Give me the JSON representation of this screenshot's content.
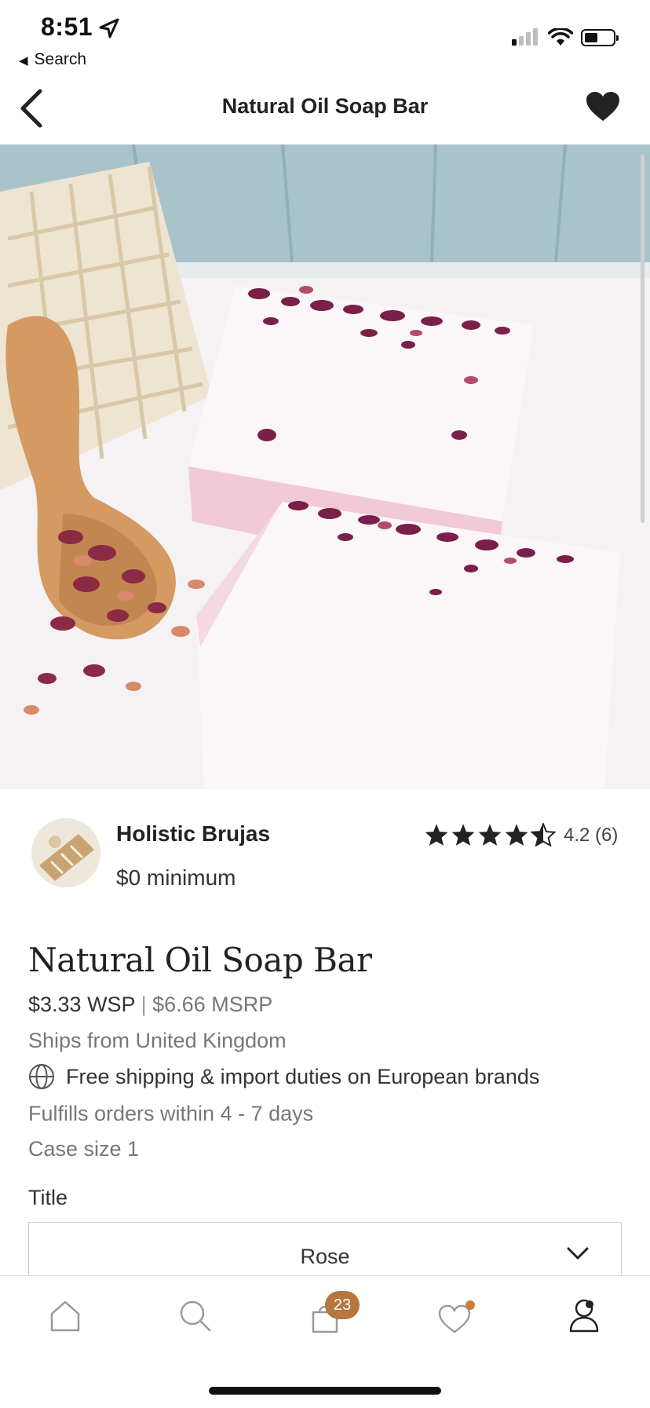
{
  "status_bar": {
    "time": "8:51",
    "back_app": "Search"
  },
  "nav": {
    "title": "Natural Oil Soap Bar",
    "back_icon": "chevron-left-icon",
    "favorite_icon": "heart-filled-icon"
  },
  "vendor": {
    "name": "Holistic Brujas",
    "minimum": "$0 minimum",
    "rating_value": 4.2,
    "rating_text": "4.2 (6)"
  },
  "product": {
    "title": "Natural Oil Soap Bar",
    "wsp": "$3.33 WSP",
    "separator": "|",
    "msrp": "$6.66 MSRP",
    "ships_from": "Ships from United Kingdom",
    "free_shipping": "Free shipping & import duties on European brands",
    "fulfills": "Fulfills orders within 4 - 7 days",
    "case_size": "Case size 1"
  },
  "variant": {
    "label": "Title",
    "selected": "Rose"
  },
  "tabbar": {
    "items": [
      {
        "icon": "home-icon"
      },
      {
        "icon": "search-icon"
      },
      {
        "icon": "bag-icon",
        "badge": "23"
      },
      {
        "icon": "heart-icon"
      },
      {
        "icon": "account-icon"
      }
    ]
  },
  "colors": {
    "accent": "#b6763e",
    "text": "#222222",
    "muted": "#777777"
  }
}
